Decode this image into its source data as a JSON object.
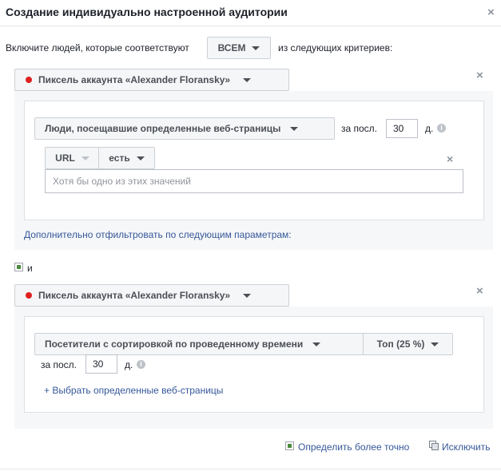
{
  "dialog": {
    "title": "Создание индивидуально настроенной аудитории",
    "close_icon": "×"
  },
  "include_row": {
    "prefix": "Включите людей, которые соответствуют",
    "match_mode": "ВСЕМ",
    "suffix": "из следующих критериев:"
  },
  "rules": [
    {
      "source": "Пиксель аккаунта «Alexander Floransky»",
      "remove_icon": "×",
      "event": "Люди, посещавшие определенные веб-страницы",
      "window_prefix": "за посл.",
      "days": "30",
      "days_unit": "д.",
      "info_icon": "i",
      "filter": {
        "field": "URL",
        "operator": "есть",
        "placeholder": "Хотя бы одно из этих значений",
        "remove_icon": "×"
      },
      "refine_link": "Дополнительно отфильтровать по следующим параметрам:"
    },
    {
      "source": "Пиксель аккаунта «Alexander Floransky»",
      "remove_icon": "×",
      "event": "Посетители с сортировкой по проведенному времени",
      "top": "Топ (25 %)",
      "window_prefix": "за посл.",
      "days": "30",
      "days_unit": "д.",
      "info_icon": "i",
      "pages_link": "+ Выбрать определенные веб-страницы"
    }
  ],
  "and_label": "и",
  "footer": {
    "narrow": "Определить более точно",
    "exclude": "Исключить"
  }
}
